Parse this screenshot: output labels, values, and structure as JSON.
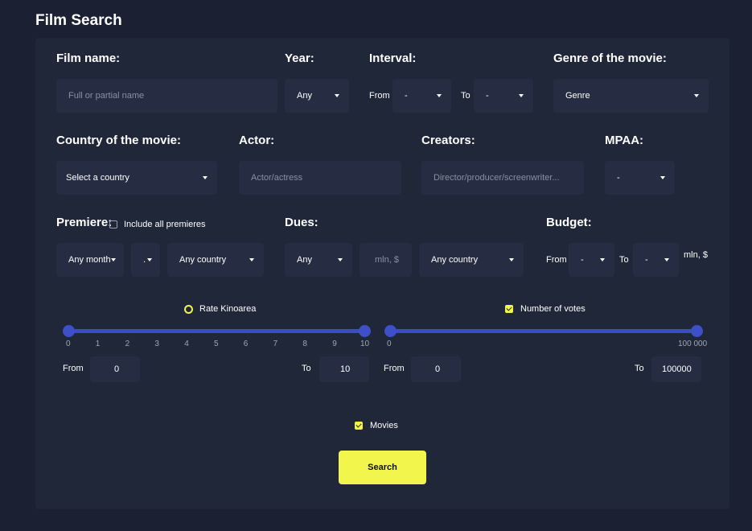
{
  "page_title": "Film Search",
  "film_name": {
    "label": "Film name:",
    "placeholder": "Full or partial name"
  },
  "year": {
    "label": "Year:",
    "value": "Any"
  },
  "interval": {
    "label": "Interval:",
    "from_label": "From",
    "from_value": "-",
    "to_label": "To",
    "to_value": "-"
  },
  "genre": {
    "label": "Genre of the movie:",
    "value": "Genre"
  },
  "country": {
    "label": "Country of the movie:",
    "value": "Select a country"
  },
  "actor": {
    "label": "Actor:",
    "placeholder": "Actor/actress"
  },
  "creators": {
    "label": "Creators:",
    "placeholder": "Director/producer/screenwriter..."
  },
  "mpaa": {
    "label": "MPAA:",
    "value": "-"
  },
  "premiere": {
    "label": "Premiere:",
    "include_label": "Include all premieres",
    "month": "Any month",
    "day": ".",
    "country": "Any country"
  },
  "dues": {
    "label": "Dues:",
    "value": "Any",
    "amount_placeholder": "mln, $",
    "country": "Any country"
  },
  "budget": {
    "label": "Budget:",
    "from_label": "From",
    "from_value": "-",
    "to_label": "To",
    "to_value": "-",
    "unit": "mln, $"
  },
  "rating": {
    "label": "Rate Kinoarea",
    "ticks": [
      "0",
      "1",
      "2",
      "3",
      "4",
      "5",
      "6",
      "7",
      "8",
      "9",
      "10"
    ],
    "from_label": "From",
    "from_value": "0",
    "to_label": "To",
    "to_value": "10",
    "range_min": 0,
    "range_max": 10,
    "selected_min": 0,
    "selected_max": 10
  },
  "votes": {
    "label": "Number of votes",
    "tick_min": "0",
    "tick_max": "100 000",
    "from_label": "From",
    "from_value": "0",
    "to_label": "To",
    "to_value": "100000",
    "range_min": 0,
    "range_max": 100000,
    "selected_min": 0,
    "selected_max": 100000
  },
  "movies_label": "Movies",
  "search_button": "Search",
  "colors": {
    "background": "#1b2132",
    "panel": "#202739",
    "field": "#262d42",
    "accent": "#f2f54b",
    "slider": "#3b4cc4"
  }
}
